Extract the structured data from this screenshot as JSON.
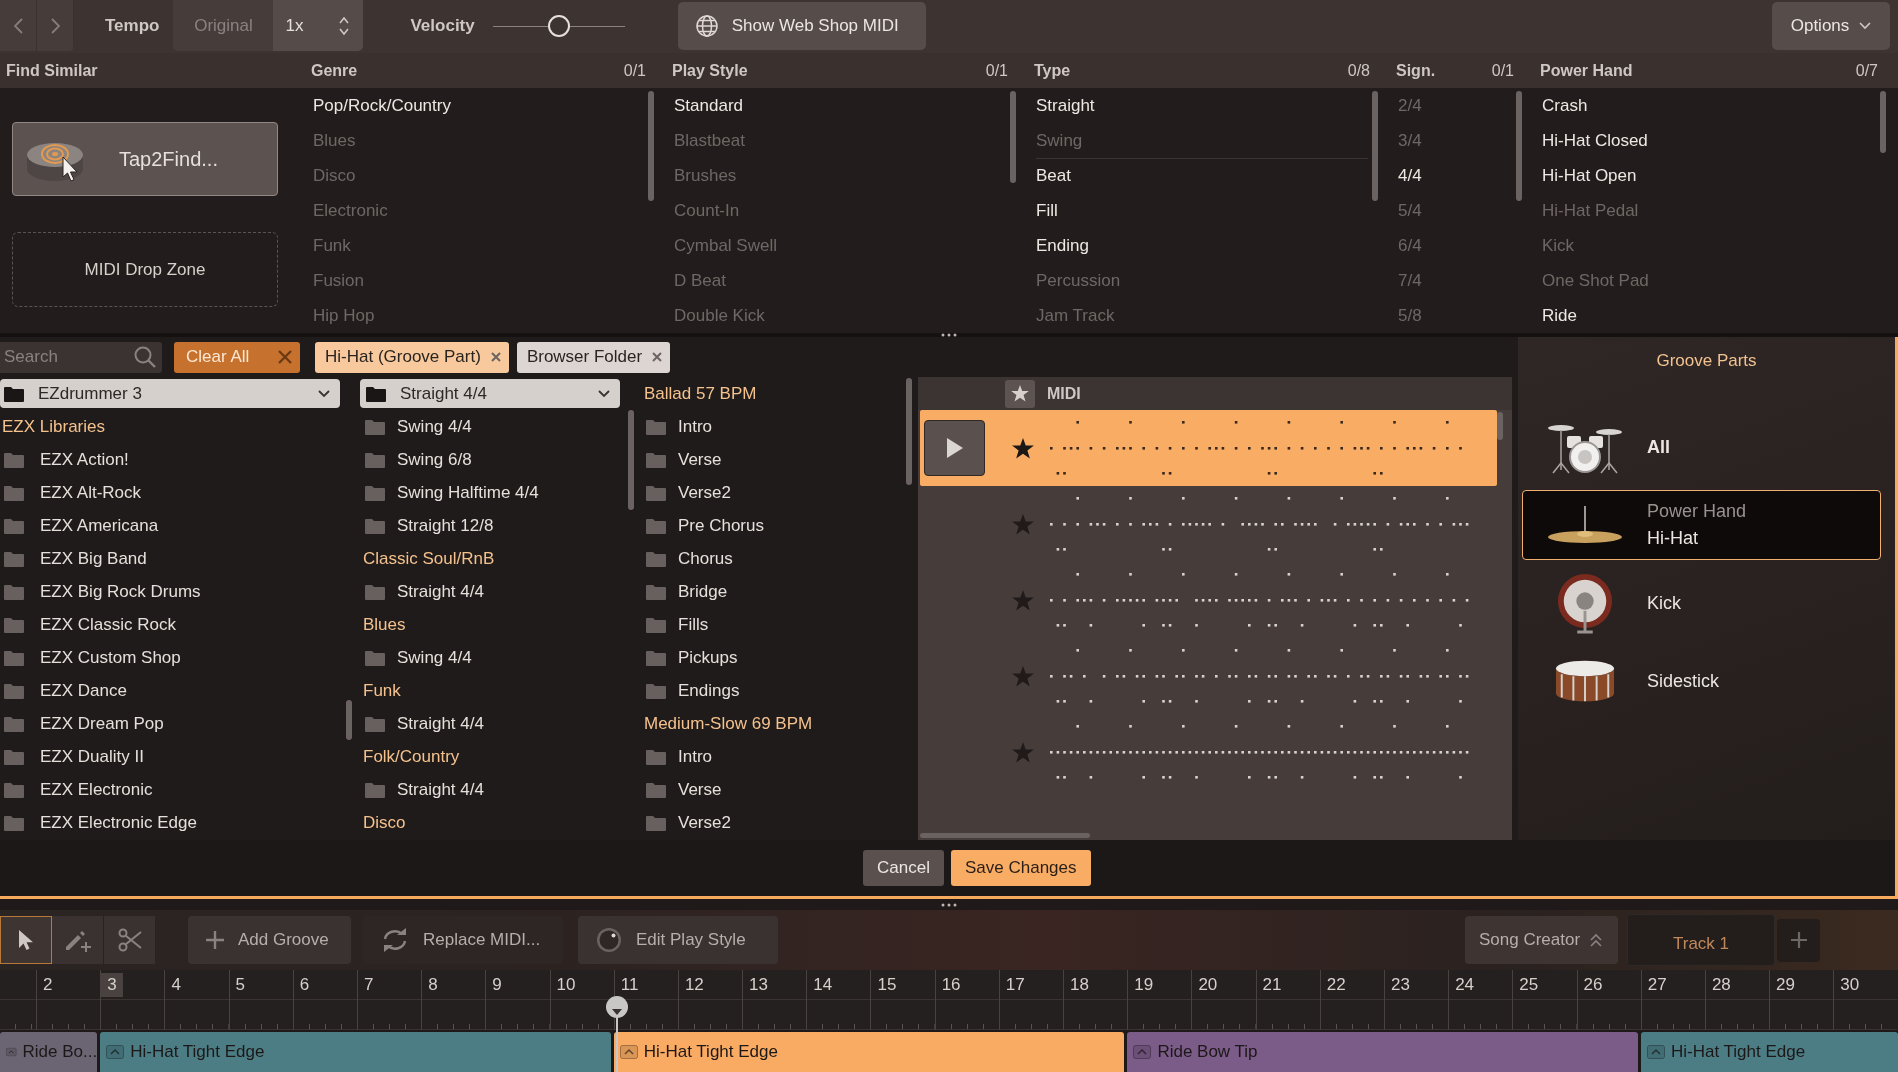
{
  "top_bar": {
    "tempo_label": "Tempo",
    "tempo_original": {
      "label": "Original",
      "on": false
    },
    "tempo_value": "1x",
    "velocity_label": "Velocity",
    "velocity": {
      "level": 0.5
    },
    "web_shop_button": "Show Web Shop MIDI",
    "options_button": "Options"
  },
  "find_similar": {
    "title": "Find Similar",
    "tap2find_button": "Tap2Find...",
    "drop_zone": "MIDI Drop Zone"
  },
  "filters": [
    {
      "title": "Genre",
      "count": "0/1",
      "groups": [
        {
          "items": [
            {
              "label": "Pop/Rock/Country",
              "available": true
            },
            {
              "label": "Blues",
              "available": false
            },
            {
              "label": "Disco",
              "available": false
            },
            {
              "label": "Electronic",
              "available": false
            },
            {
              "label": "Funk",
              "available": false
            },
            {
              "label": "Fusion",
              "available": false
            },
            {
              "label": "Hip Hop",
              "available": false
            }
          ]
        }
      ]
    },
    {
      "title": "Play Style",
      "count": "0/1",
      "groups": [
        {
          "items": [
            {
              "label": "Standard",
              "available": true
            },
            {
              "label": "Blastbeat",
              "available": false
            },
            {
              "label": "Brushes",
              "available": false
            },
            {
              "label": "Count-In",
              "available": false
            },
            {
              "label": "Cymbal Swell",
              "available": false
            },
            {
              "label": "D Beat",
              "available": false
            },
            {
              "label": "Double Kick",
              "available": false
            }
          ]
        }
      ]
    },
    {
      "title": "Type",
      "count": "0/8",
      "groups": [
        {
          "items": [
            {
              "label": "Straight",
              "available": true
            },
            {
              "label": "Swing",
              "available": false
            }
          ]
        },
        {
          "items": [
            {
              "label": "Beat",
              "available": true
            },
            {
              "label": "Fill",
              "available": true
            },
            {
              "label": "Ending",
              "available": true
            },
            {
              "label": "Percussion",
              "available": false
            },
            {
              "label": "Jam Track",
              "available": false
            }
          ]
        }
      ]
    },
    {
      "title": "Sign.",
      "count": "0/1",
      "groups": [
        {
          "items": [
            {
              "label": "2/4",
              "available": false
            },
            {
              "label": "3/4",
              "available": false
            },
            {
              "label": "4/4",
              "available": true
            },
            {
              "label": "5/4",
              "available": false
            },
            {
              "label": "6/4",
              "available": false
            },
            {
              "label": "7/4",
              "available": false
            },
            {
              "label": "5/8",
              "available": false
            }
          ]
        }
      ]
    },
    {
      "title": "Power Hand",
      "count": "0/7",
      "groups": [
        {
          "items": [
            {
              "label": "Crash",
              "available": true
            },
            {
              "label": "Hi-Hat Closed",
              "available": true
            },
            {
              "label": "Hi-Hat Open",
              "available": true
            },
            {
              "label": "Hi-Hat Pedal",
              "available": false
            },
            {
              "label": "Kick",
              "available": false
            },
            {
              "label": "One Shot Pad",
              "available": false
            },
            {
              "label": "Ride",
              "available": true
            }
          ]
        }
      ]
    }
  ],
  "browser": {
    "search": {
      "placeholder": "Search"
    },
    "clear_all_button": "Clear All",
    "tags": [
      {
        "label": "Hi-Hat (Groove Part)",
        "color": "#f8c99c"
      },
      {
        "label": "Browser Folder",
        "color": "#dcd5d2"
      }
    ],
    "columns": [
      {
        "dropdown": "EZdrummer 3",
        "items": [
          {
            "kind": "header",
            "label": "EZX Libraries"
          },
          {
            "kind": "folder",
            "label": "EZX Action!"
          },
          {
            "kind": "folder",
            "label": "EZX Alt-Rock"
          },
          {
            "kind": "folder",
            "label": "EZX Americana"
          },
          {
            "kind": "folder",
            "label": "EZX Big Band"
          },
          {
            "kind": "folder",
            "label": "EZX Big Rock Drums"
          },
          {
            "kind": "folder",
            "label": "EZX Classic Rock"
          },
          {
            "kind": "folder",
            "label": "EZX Custom Shop"
          },
          {
            "kind": "folder",
            "label": "EZX Dance"
          },
          {
            "kind": "folder",
            "label": "EZX Dream Pop"
          },
          {
            "kind": "folder",
            "label": "EZX Duality II"
          },
          {
            "kind": "folder",
            "label": "EZX Electronic"
          },
          {
            "kind": "folder",
            "label": "EZX Electronic Edge"
          }
        ]
      },
      {
        "dropdown": "Straight 4/4",
        "items": [
          {
            "kind": "folder",
            "label": "Swing 4/4"
          },
          {
            "kind": "folder",
            "label": "Swing 6/8"
          },
          {
            "kind": "folder",
            "label": "Swing Halftime 4/4"
          },
          {
            "kind": "folder",
            "label": "Straight 12/8"
          },
          {
            "kind": "header",
            "label": "Classic Soul/RnB"
          },
          {
            "kind": "folder",
            "label": "Straight 4/4"
          },
          {
            "kind": "header",
            "label": "Blues"
          },
          {
            "kind": "folder",
            "label": "Swing 4/4"
          },
          {
            "kind": "header",
            "label": "Funk"
          },
          {
            "kind": "folder",
            "label": "Straight 4/4"
          },
          {
            "kind": "header",
            "label": "Folk/Country"
          },
          {
            "kind": "folder",
            "label": "Straight 4/4"
          },
          {
            "kind": "header",
            "label": "Disco"
          }
        ]
      },
      {
        "items": [
          {
            "kind": "header",
            "label": "Ballad 57 BPM"
          },
          {
            "kind": "folder",
            "label": "Intro"
          },
          {
            "kind": "folder",
            "label": "Verse"
          },
          {
            "kind": "folder",
            "label": "Verse2"
          },
          {
            "kind": "folder",
            "label": "Pre Chorus"
          },
          {
            "kind": "folder",
            "label": "Chorus"
          },
          {
            "kind": "folder",
            "label": "Bridge"
          },
          {
            "kind": "folder",
            "label": "Fills"
          },
          {
            "kind": "folder",
            "label": "Pickups"
          },
          {
            "kind": "folder",
            "label": "Endings"
          },
          {
            "kind": "header",
            "label": "Medium-Slow 69 BPM"
          },
          {
            "kind": "folder",
            "label": "Intro"
          },
          {
            "kind": "folder",
            "label": "Verse"
          },
          {
            "kind": "folder",
            "label": "Verse2"
          }
        ]
      }
    ],
    "midi": {
      "header": "MIDI",
      "rows": [
        {
          "selected": true
        },
        {
          "selected": false
        },
        {
          "selected": false
        },
        {
          "selected": false
        },
        {
          "selected": false
        }
      ]
    },
    "groove_parts": {
      "title": "Groove Parts",
      "items": [
        {
          "kind": "kit",
          "label": "All",
          "selected": false
        },
        {
          "kind": "cymbal",
          "category": "Power Hand",
          "label": "Hi-Hat",
          "selected": true
        },
        {
          "kind": "kick",
          "label": "Kick",
          "selected": false
        },
        {
          "kind": "snare",
          "label": "Sidestick",
          "selected": false
        }
      ]
    },
    "cancel_button": "Cancel",
    "save_button": "Save Changes"
  },
  "bottom_toolbar": {
    "tools": [
      {
        "kind": "select",
        "selected": true
      },
      {
        "kind": "draw",
        "selected": false
      },
      {
        "kind": "cut",
        "selected": false
      }
    ],
    "buttons": [
      {
        "kind": "add",
        "label": "Add Groove"
      },
      {
        "kind": "replace",
        "label": "Replace MIDI..."
      },
      {
        "kind": "play_style",
        "label": "Edit Play Style"
      }
    ],
    "song_creator_button": "Song Creator",
    "track_name": "Track 1"
  },
  "timeline": {
    "bars": [
      {
        "label": "2",
        "selected": false
      },
      {
        "label": "3",
        "selected": true
      },
      {
        "label": "4",
        "selected": false
      },
      {
        "label": "5",
        "selected": false
      },
      {
        "label": "6",
        "selected": false
      },
      {
        "label": "7",
        "selected": false
      },
      {
        "label": "8",
        "selected": false
      },
      {
        "label": "9",
        "selected": false
      },
      {
        "label": "10",
        "selected": false
      },
      {
        "label": "11",
        "selected": false
      },
      {
        "label": "12",
        "selected": false
      },
      {
        "label": "13",
        "selected": false
      },
      {
        "label": "14",
        "selected": false
      },
      {
        "label": "15",
        "selected": false
      },
      {
        "label": "16",
        "selected": false
      },
      {
        "label": "17",
        "selected": false
      },
      {
        "label": "18",
        "selected": false
      },
      {
        "label": "19",
        "selected": false
      },
      {
        "label": "20",
        "selected": false
      },
      {
        "label": "21",
        "selected": false
      },
      {
        "label": "22",
        "selected": false
      },
      {
        "label": "23",
        "selected": false
      },
      {
        "label": "24",
        "selected": false
      },
      {
        "label": "25",
        "selected": false
      },
      {
        "label": "26",
        "selected": false
      },
      {
        "label": "27",
        "selected": false
      },
      {
        "label": "28",
        "selected": false
      },
      {
        "label": "29",
        "selected": false
      },
      {
        "label": "30",
        "selected": false
      }
    ],
    "playhead": {
      "level": 0.325
    },
    "clips": [
      {
        "label": "Ride Bo...",
        "color": "#6b6472"
      },
      {
        "label": "Hi-Hat Tight Edge",
        "color": "#4d7d84"
      },
      {
        "label": "Hi-Hat Tight Edge",
        "color": "#f9ab63"
      },
      {
        "label": "Ride Bow Tip",
        "color": "#7b5b87"
      },
      {
        "label": "Hi-Hat Tight Edge",
        "color": "#4d7d84"
      }
    ]
  }
}
